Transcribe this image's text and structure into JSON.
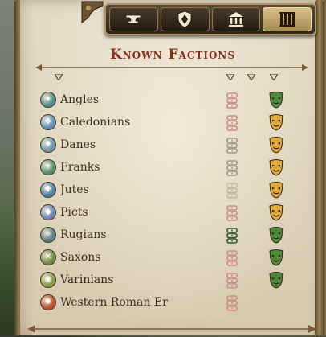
{
  "tabs": [
    {
      "icon": "anvil-icon",
      "active": false
    },
    {
      "icon": "shield-crest-icon",
      "active": false
    },
    {
      "icon": "temple-icon",
      "active": false
    },
    {
      "icon": "columns-icon",
      "active": true
    }
  ],
  "panel": {
    "title": "Known Factions"
  },
  "factions": [
    {
      "name": "Angles",
      "icon_color": "#4f8a8c",
      "icon_glyph": "✦",
      "relation_color": "#c98e86",
      "attitude": "green"
    },
    {
      "name": "Caledonians",
      "icon_color": "#5c8fb8",
      "icon_glyph": "❖",
      "relation_color": "#c98e86",
      "attitude": "gold"
    },
    {
      "name": "Danes",
      "icon_color": "#6a92a8",
      "icon_glyph": "♦",
      "relation_color": "#9e9888",
      "attitude": "gold"
    },
    {
      "name": "Franks",
      "icon_color": "#4f8e6a",
      "icon_glyph": "⚜",
      "relation_color": "#9e9888",
      "attitude": "gold"
    },
    {
      "name": "Jutes",
      "icon_color": "#4f7fa8",
      "icon_glyph": "✚",
      "relation_color": "#c2b9a5",
      "attitude": "gold"
    },
    {
      "name": "Picts",
      "icon_color": "#6b86b8",
      "icon_glyph": "◆",
      "relation_color": "#c98e86",
      "attitude": "gold"
    },
    {
      "name": "Rugians",
      "icon_color": "#5a7f82",
      "icon_glyph": "✧",
      "relation_color": "#2f5a2e",
      "attitude": "green"
    },
    {
      "name": "Saxons",
      "icon_color": "#6f8a3a",
      "icon_glyph": "✕",
      "relation_color": "#c98e86",
      "attitude": "green"
    },
    {
      "name": "Varinians",
      "icon_color": "#8a9a42",
      "icon_glyph": "◉",
      "relation_color": "#c98e86",
      "attitude": "green"
    },
    {
      "name": "Western Roman Er",
      "icon_color": "#b8502a",
      "icon_glyph": "✺",
      "relation_color": "#c98e86",
      "attitude": "none"
    }
  ],
  "colors": {
    "title": "#8a2f1c",
    "attitude_green": "#4e8a3a",
    "attitude_gold": "#e0a83a",
    "ink": "#3b2e1d"
  }
}
